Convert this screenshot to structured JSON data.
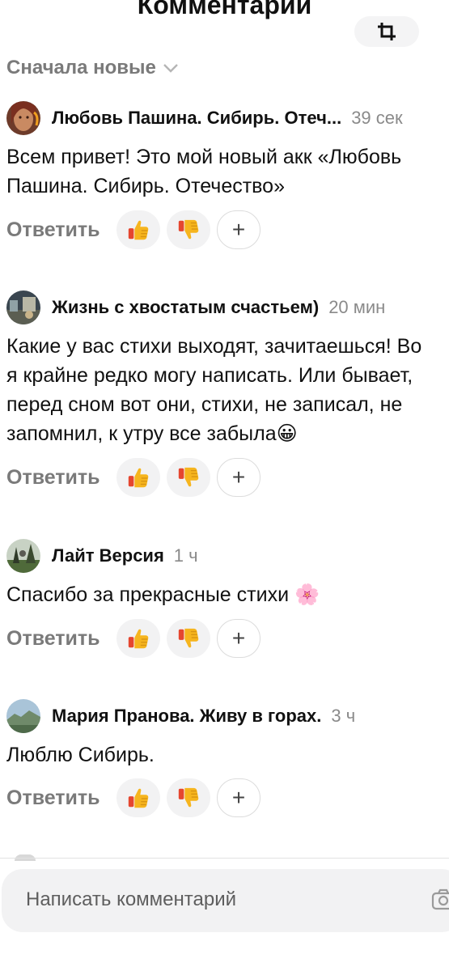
{
  "header": {
    "title": "Комментарии"
  },
  "sort": {
    "label": "Сначала новые"
  },
  "comments": [
    {
      "author": "Любовь Пашина. Сибирь. Отеч...",
      "time": "39 сек",
      "lines": [
        "Всем привет!  Это мой новый акк «Любовь",
        "Пашина. Сибирь. Отечество»"
      ],
      "reply": "Ответить"
    },
    {
      "author": "Жизнь с хвостатым счастьем)",
      "time": "20 мин",
      "lines": [
        "Какие у вас стихи выходят, зачитаешься! Во",
        "я крайне редко могу написать. Или бывает,",
        "перед сном вот они, стихи, не записал, не",
        "запомнил, к утру все забыла😀"
      ],
      "reply": "Ответить"
    },
    {
      "author": "Лайт Версия",
      "time": "1 ч",
      "lines": [
        "Спасибо за прекрасные стихи 🌸"
      ],
      "reply": "Ответить"
    },
    {
      "author": "Мария Пранова. Живу в горах.",
      "time": "3 ч",
      "lines": [
        "Люблю Сибирь."
      ],
      "reply": "Ответить"
    }
  ],
  "composer": {
    "placeholder": "Написать комментарий"
  },
  "icons": {
    "crop": "crop-icon",
    "sort": "chevron-down-icon",
    "like": "thumbs-up-icon",
    "dislike": "thumbs-down-icon",
    "add_reaction": "plus-icon",
    "camera": "camera-icon"
  },
  "colors": {
    "muted_text": "#7a7a7a",
    "pill_bg": "#f2f2f3",
    "thumb_yellow": "#f6b51e",
    "thumb_red": "#d93a2b"
  }
}
